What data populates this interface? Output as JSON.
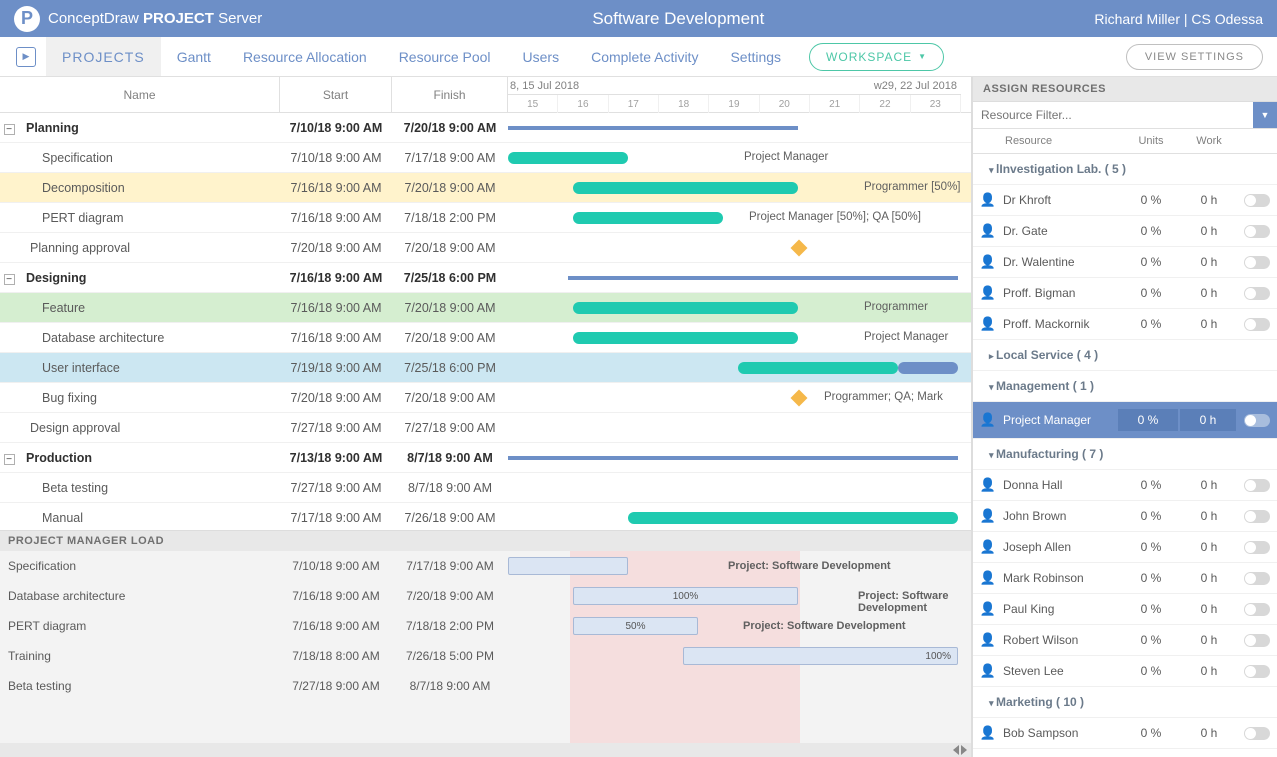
{
  "header": {
    "brand_light1": "ConceptDraw ",
    "brand_bold": "PROJECT",
    "brand_light2": " Server",
    "page_title": "Software Development",
    "user": "Richard Miller | CS Odessa"
  },
  "nav": {
    "projects": "PROJECTS",
    "gantt": "Gantt",
    "resource_allocation": "Resource Allocation",
    "resource_pool": "Resource Pool",
    "users": "Users",
    "complete_activity": "Complete Activity",
    "settings": "Settings",
    "workspace": "WORKSPACE",
    "view_settings": "VIEW SETTINGS"
  },
  "gantt_cols": {
    "name": "Name",
    "start": "Start",
    "finish": "Finish"
  },
  "timeline": {
    "week1": "8, 15 Jul 2018",
    "week2": "w29, 22 Jul 2018",
    "days": [
      "15",
      "16",
      "17",
      "18",
      "19",
      "20",
      "21",
      "22",
      "23"
    ]
  },
  "tasks": [
    {
      "id": "planning",
      "name": "Planning",
      "start": "7/10/18 9:00 AM",
      "finish": "7/20/18 9:00 AM",
      "group": true
    },
    {
      "id": "spec",
      "name": "Specification",
      "start": "7/10/18 9:00 AM",
      "finish": "7/17/18 9:00 AM",
      "res": "Project Manager"
    },
    {
      "id": "decomp",
      "name": "Decomposition",
      "start": "7/16/18 9:00 AM",
      "finish": "7/20/18 9:00 AM",
      "res": "Programmer [50%]",
      "hl": "yellow"
    },
    {
      "id": "pert",
      "name": "PERT diagram",
      "start": "7/16/18 9:00 AM",
      "finish": "7/18/18 2:00 PM",
      "res": "Project Manager [50%]; QA [50%]"
    },
    {
      "id": "plan-appr",
      "name": "Planning approval",
      "start": "7/20/18 9:00 AM",
      "finish": "7/20/18 9:00 AM",
      "milestone": true,
      "indent": 1
    },
    {
      "id": "designing",
      "name": "Designing",
      "start": "7/16/18 9:00 AM",
      "finish": "7/25/18 6:00 PM",
      "group": true
    },
    {
      "id": "feature",
      "name": "Feature",
      "start": "7/16/18 9:00 AM",
      "finish": "7/20/18 9:00 AM",
      "res": "Programmer",
      "hl": "green"
    },
    {
      "id": "dbarch",
      "name": "Database architecture",
      "start": "7/16/18 9:00 AM",
      "finish": "7/20/18 9:00 AM",
      "res": "Project Manager"
    },
    {
      "id": "ui",
      "name": "User interface",
      "start": "7/19/18 9:00 AM",
      "finish": "7/25/18 6:00 PM",
      "hl": "blue"
    },
    {
      "id": "bugfix",
      "name": "Bug fixing",
      "start": "7/20/18 9:00 AM",
      "finish": "7/20/18 9:00 AM",
      "res": "Programmer; QA; Mark",
      "milestone": true
    },
    {
      "id": "des-appr",
      "name": "Design approval",
      "start": "7/27/18 9:00 AM",
      "finish": "7/27/18 9:00 AM",
      "indent": 1
    },
    {
      "id": "production",
      "name": "Production",
      "start": "7/13/18 9:00 AM",
      "finish": "8/7/18 9:00 AM",
      "group": true
    },
    {
      "id": "beta",
      "name": "Beta testing",
      "start": "7/27/18 9:00 AM",
      "finish": "8/7/18 9:00 AM"
    },
    {
      "id": "manual",
      "name": "Manual",
      "start": "7/17/18 9:00 AM",
      "finish": "7/26/18 9:00 AM"
    }
  ],
  "load": {
    "title": "PROJECT MANAGER LOAD",
    "project_label": "Project: Software Development",
    "rows": [
      {
        "name": "Specification",
        "start": "7/10/18 9:00 AM",
        "finish": "7/17/18 9:00 AM",
        "pct": ""
      },
      {
        "name": "Database architecture",
        "start": "7/16/18 9:00 AM",
        "finish": "7/20/18 9:00 AM",
        "pct": "100%"
      },
      {
        "name": "PERT diagram",
        "start": "7/16/18 9:00 AM",
        "finish": "7/18/18 2:00 PM",
        "pct": "50%"
      },
      {
        "name": "Training",
        "start": "7/18/18 8:00 AM",
        "finish": "7/26/18 5:00 PM",
        "pct": "100%"
      },
      {
        "name": "Beta testing",
        "start": "7/27/18 9:00 AM",
        "finish": "8/7/18 9:00 AM",
        "pct": ""
      }
    ]
  },
  "assign": {
    "title": "ASSIGN RESOURCES",
    "filter_placeholder": "Resource Filter...",
    "col_resource": "Resource",
    "col_units": "Units",
    "col_work": "Work",
    "groups": {
      "g1": "lInvestigation Lab. ( 5 )",
      "g2": "Local Service ( 4 )",
      "g3": "Management ( 1 )",
      "g4": "Manufacturing ( 7 )",
      "g5": "Marketing ( 10 )"
    },
    "g1_items": [
      {
        "name": "Dr Khroft",
        "units": "0 %",
        "work": "0 h"
      },
      {
        "name": "Dr. Gate",
        "units": "0 %",
        "work": "0 h"
      },
      {
        "name": "Dr. Walentine",
        "units": "0 %",
        "work": "0 h"
      },
      {
        "name": "Proff. Bigman",
        "units": "0 %",
        "work": "0 h"
      },
      {
        "name": "Proff. Mackornik",
        "units": "0 %",
        "work": "0 h"
      }
    ],
    "g3_items": [
      {
        "name": "Project Manager",
        "units": "0 %",
        "work": "0 h"
      }
    ],
    "g4_items": [
      {
        "name": "Donna Hall",
        "units": "0 %",
        "work": "0 h"
      },
      {
        "name": "John Brown",
        "units": "0 %",
        "work": "0 h"
      },
      {
        "name": "Joseph Allen",
        "units": "0 %",
        "work": "0 h"
      },
      {
        "name": "Mark Robinson",
        "units": "0 %",
        "work": "0 h"
      },
      {
        "name": "Paul King",
        "units": "0 %",
        "work": "0 h"
      },
      {
        "name": "Robert Wilson",
        "units": "0 %",
        "work": "0 h"
      },
      {
        "name": "Steven Lee",
        "units": "0 %",
        "work": "0 h"
      }
    ],
    "g5_items": [
      {
        "name": "Bob Sampson",
        "units": "0 %",
        "work": "0 h"
      }
    ]
  },
  "chart_data": {
    "type": "gantt",
    "time_axis": {
      "start": "2018-07-15",
      "end": "2018-07-23",
      "unit": "days"
    },
    "tasks": [
      {
        "name": "Planning",
        "start": "2018-07-10",
        "end": "2018-07-20",
        "type": "summary"
      },
      {
        "name": "Specification",
        "start": "2018-07-10",
        "end": "2018-07-17",
        "resource": "Project Manager"
      },
      {
        "name": "Decomposition",
        "start": "2018-07-16",
        "end": "2018-07-20",
        "resource": "Programmer 50%"
      },
      {
        "name": "PERT diagram",
        "start": "2018-07-16",
        "end": "2018-07-18",
        "resource": "Project Manager 50%; QA 50%"
      },
      {
        "name": "Planning approval",
        "start": "2018-07-20",
        "type": "milestone"
      },
      {
        "name": "Designing",
        "start": "2018-07-16",
        "end": "2018-07-25",
        "type": "summary"
      },
      {
        "name": "Feature",
        "start": "2018-07-16",
        "end": "2018-07-20",
        "resource": "Programmer"
      },
      {
        "name": "Database architecture",
        "start": "2018-07-16",
        "end": "2018-07-20",
        "resource": "Project Manager"
      },
      {
        "name": "User interface",
        "start": "2018-07-19",
        "end": "2018-07-25"
      },
      {
        "name": "Bug fixing",
        "start": "2018-07-20",
        "type": "milestone",
        "resource": "Programmer; QA; Mark"
      },
      {
        "name": "Design approval",
        "start": "2018-07-27",
        "type": "milestone"
      },
      {
        "name": "Production",
        "start": "2018-07-13",
        "end": "2018-08-07",
        "type": "summary"
      },
      {
        "name": "Beta testing",
        "start": "2018-07-27",
        "end": "2018-08-07"
      },
      {
        "name": "Manual",
        "start": "2018-07-17",
        "end": "2018-07-26"
      }
    ],
    "load_chart": [
      {
        "name": "Specification",
        "start": "2018-07-10",
        "end": "2018-07-17",
        "pct": null
      },
      {
        "name": "Database architecture",
        "start": "2018-07-16",
        "end": "2018-07-20",
        "pct": 100
      },
      {
        "name": "PERT diagram",
        "start": "2018-07-16",
        "end": "2018-07-18",
        "pct": 50
      },
      {
        "name": "Training",
        "start": "2018-07-18",
        "end": "2018-07-26",
        "pct": 100
      },
      {
        "name": "Beta testing",
        "start": "2018-07-27",
        "end": "2018-08-07",
        "pct": null
      }
    ]
  }
}
